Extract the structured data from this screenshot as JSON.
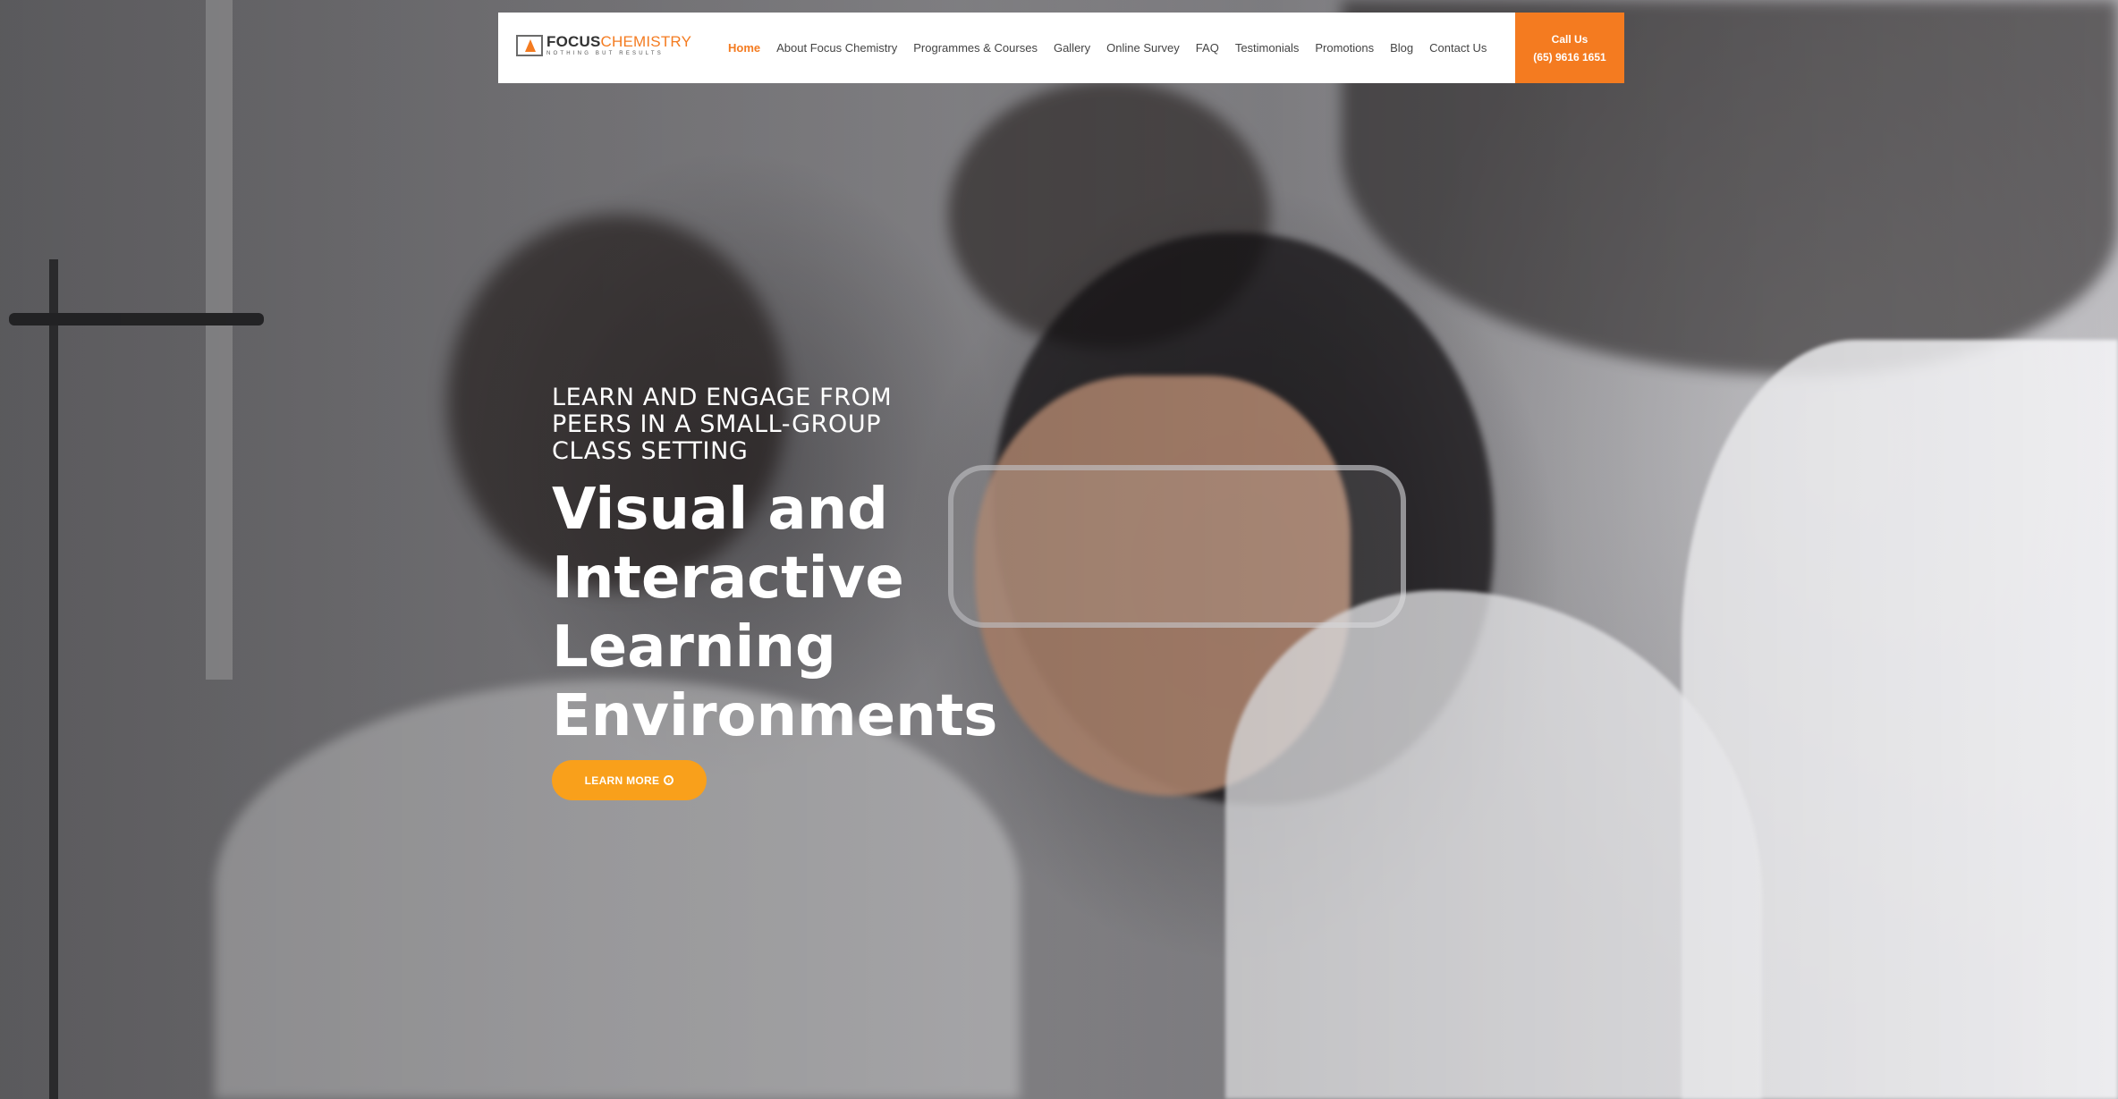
{
  "header": {
    "logo": {
      "title_part1": "FOCUS",
      "title_part2": "CHEMISTRY",
      "tagline": "NOTHING BUT RESULTS"
    },
    "nav": [
      {
        "label": "Home",
        "active": true
      },
      {
        "label": "About Focus Chemistry",
        "active": false
      },
      {
        "label": "Programmes & Courses",
        "active": false
      },
      {
        "label": "Gallery",
        "active": false
      },
      {
        "label": "Online Survey",
        "active": false
      },
      {
        "label": "FAQ",
        "active": false
      },
      {
        "label": "Testimonials",
        "active": false
      },
      {
        "label": "Promotions",
        "active": false
      },
      {
        "label": "Blog",
        "active": false
      },
      {
        "label": "Contact Us",
        "active": false
      }
    ],
    "call": {
      "label": "Call Us",
      "phone": "(65) 9616 1651"
    }
  },
  "hero": {
    "eyebrow": "LEARN AND ENGAGE FROM PEERS IN A SMALL-GROUP CLASS SETTING",
    "headline": "Visual and Interactive Learning Environments",
    "button_label": "LEARN MORE",
    "button_icon": "arrow-circle-right-icon"
  },
  "colors": {
    "accent": "#f47b20",
    "button": "#f9a01b",
    "header_bg": "#ffffff"
  }
}
